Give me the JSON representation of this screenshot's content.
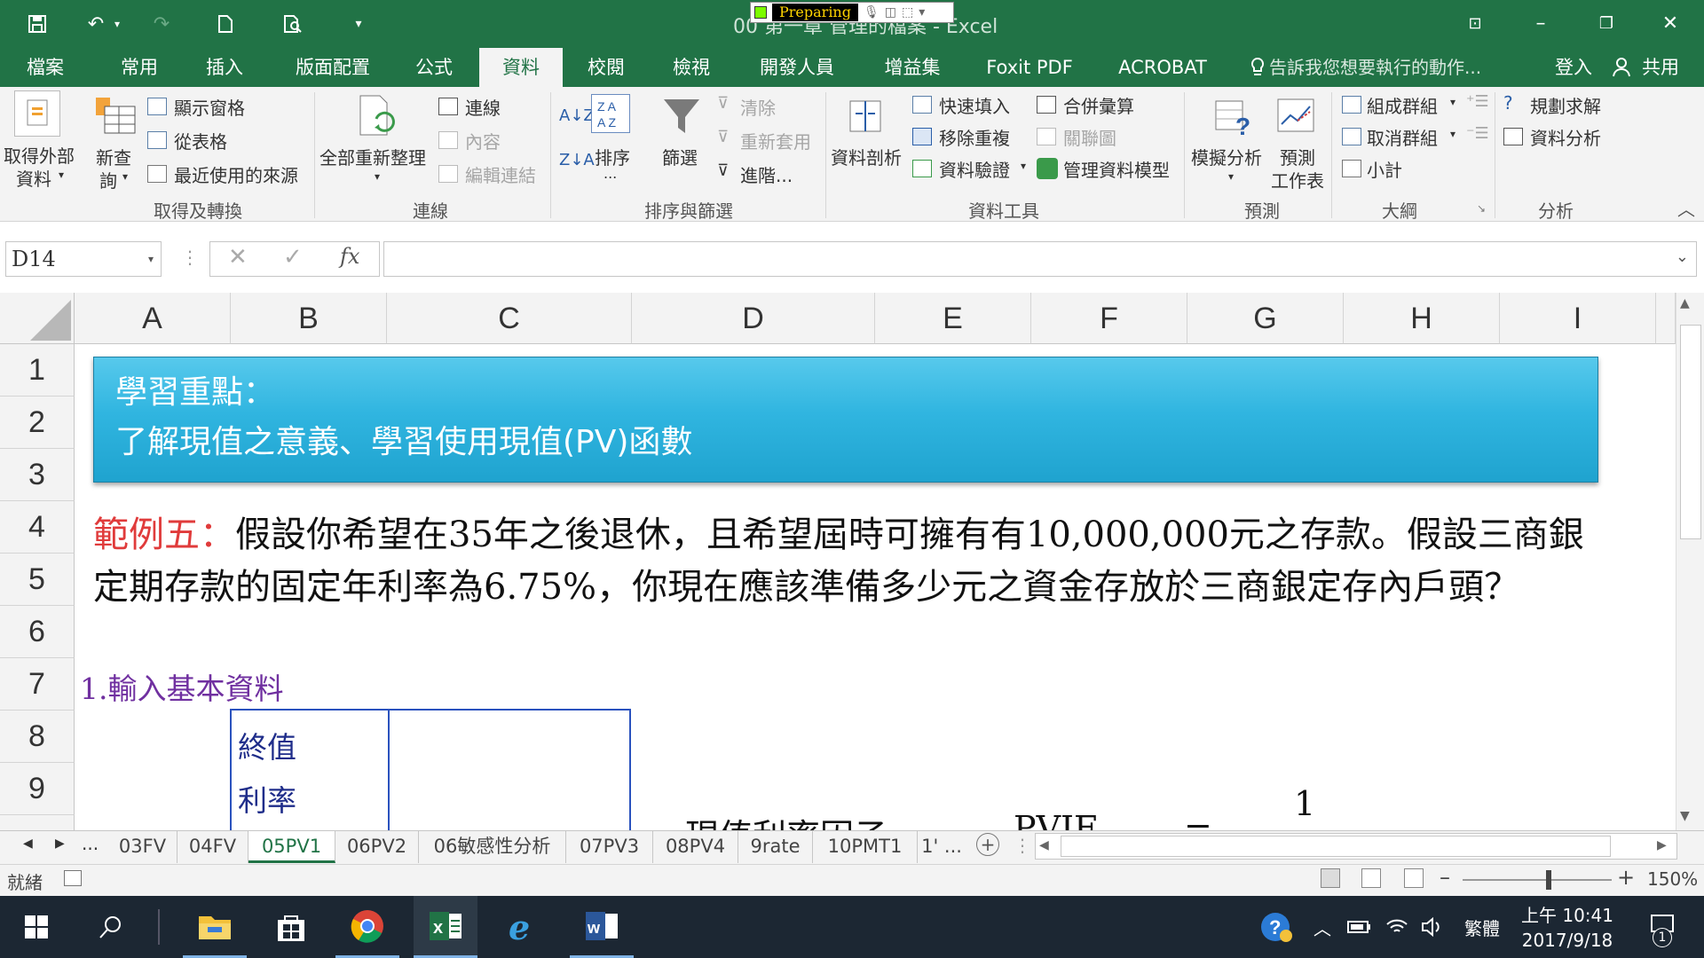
{
  "titlebar": {
    "doc_title": "00 第一章 管理的檔案 - Excel",
    "recorder_label": "Preparing"
  },
  "tabs": [
    {
      "label": "檔案"
    },
    {
      "label": "常用"
    },
    {
      "label": "插入"
    },
    {
      "label": "版面配置"
    },
    {
      "label": "公式"
    },
    {
      "label": "資料"
    },
    {
      "label": "校閱"
    },
    {
      "label": "檢視"
    },
    {
      "label": "開發人員"
    },
    {
      "label": "增益集"
    },
    {
      "label": "Foxit PDF"
    },
    {
      "label": "ACROBAT"
    }
  ],
  "tell_me": "告訴我您想要執行的動作...",
  "signin": "登入",
  "share": "共用",
  "ribbon": {
    "get_external": "取得外部",
    "get_external2": "資料",
    "new_query": "新查",
    "new_query2": "詢",
    "show_queries": "顯示窗格",
    "from_table": "從表格",
    "recent_sources": "最近使用的來源",
    "group_get_transform": "取得及轉換",
    "refresh_all": "全部重新整理",
    "connections": "連線",
    "properties": "內容",
    "edit_links": "編輯連結",
    "group_connections": "連線",
    "sort": "排序",
    "sort_dots": "...",
    "filter": "篩選",
    "clear": "清除",
    "reapply": "重新套用",
    "advanced": "進階...",
    "group_sort_filter": "排序與篩選",
    "text_to_columns": "資料剖析",
    "flash_fill": "快速填入",
    "remove_duplicates": "移除重複",
    "data_validation": "資料驗證",
    "consolidate": "合併彙算",
    "relationships": "關聯圖",
    "manage_data_model": "管理資料模型",
    "group_data_tools": "資料工具",
    "what_if": "模擬分析",
    "forecast_sheet": "預測",
    "forecast_sheet2": "工作表",
    "group_forecast": "預測",
    "group": "組成群組",
    "ungroup": "取消群組",
    "subtotal": "小計",
    "group_outline": "大綱",
    "solver": "規劃求解",
    "data_analysis": "資料分析",
    "group_analysis": "分析"
  },
  "formula_bar": {
    "name_box": "D14",
    "fx": "fx",
    "value": ""
  },
  "columns": [
    "A",
    "B",
    "C",
    "D",
    "E",
    "F",
    "G",
    "H",
    "I"
  ],
  "rows": [
    "1",
    "2",
    "3",
    "4",
    "5",
    "6",
    "7",
    "8",
    "9"
  ],
  "sheet": {
    "banner_line1": "學習重點：",
    "banner_line2": "了解現值之意義、學習使用現值(PV)函數",
    "example_label": "範例五：",
    "example_line1": "假設你希望在35年之後退休，且希望屆時可擁有有10,000,000元之存款。假設三商銀",
    "example_line2": "定期存款的固定年利率為6.75%，你現在應該準備多少元之資金存放於三商銀定存內戶頭？",
    "step1": "1.輸入基本資料",
    "fv_label": "終值",
    "rate_label": "利率",
    "formula_label": "現值利率因子",
    "pvif": "PVIF",
    "equals": "=",
    "numerator": "1"
  },
  "sheet_tabs": [
    "03FV",
    "04FV",
    "05PV1",
    "06PV2",
    "06敏感性分析",
    "07PV3",
    "08PV4",
    "9rate",
    "10PMT1",
    "1' ..."
  ],
  "active_sheet": "05PV1",
  "status": {
    "ready": "就緒",
    "zoom": "150%"
  },
  "taskbar": {
    "ime": "繁體",
    "time": "上午 10:41",
    "date": "2017/9/18",
    "notif_count": "1"
  },
  "colors": {
    "excel_green": "#217346",
    "banner_blue": "#30b5e0",
    "example_red": "#e03b3b",
    "step_purple": "#7030a0"
  }
}
